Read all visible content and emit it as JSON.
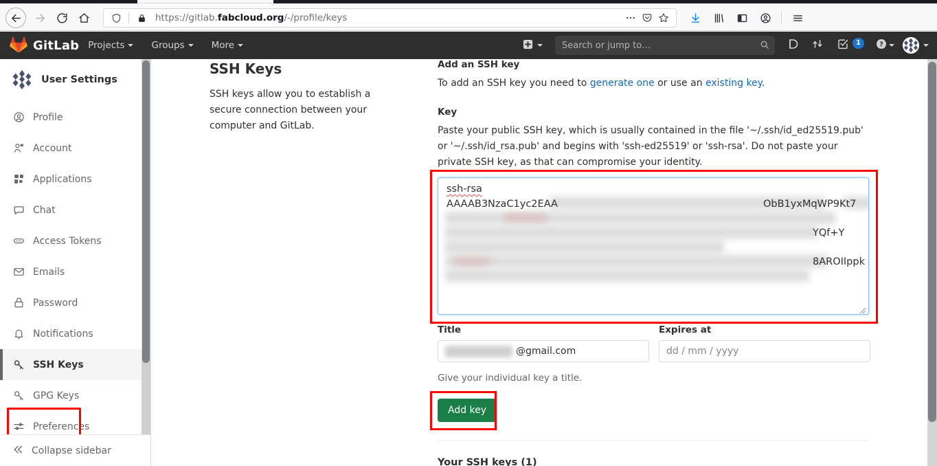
{
  "browser": {
    "url_scheme": "https://gitlab.",
    "url_domain": "fabcloud.org",
    "url_path": "/-/profile/keys",
    "back_icon": "back-arrow-icon",
    "forward_icon": "forward-arrow-icon",
    "reload_icon": "reload-icon",
    "home_icon": "home-icon",
    "shield_icon": "tracking-protection-shield-icon",
    "lock_icon": "padlock-icon",
    "page_actions_icon": "ellipsis-icon",
    "pocket_icon": "pocket-icon",
    "bookmark_icon": "star-icon",
    "download_icon": "downloads-icon",
    "library_icon": "library-icon",
    "sidebar_icon": "sidebar-toggle-icon",
    "account_icon": "firefox-account-icon",
    "menu_icon": "hamburger-menu-icon"
  },
  "navbar": {
    "brand": "GitLab",
    "brand_icon": "gitlab-tanuki-logo",
    "items": [
      {
        "label": "Projects",
        "caret": true
      },
      {
        "label": "Groups",
        "caret": true
      },
      {
        "label": "More",
        "caret": true
      }
    ],
    "plus_icon": "plus-square-icon",
    "search_placeholder": "Search or jump to…",
    "search_value": "",
    "search_icon": "search-icon",
    "issues_icon": "issues-icon",
    "merge_requests_icon": "merge-request-icon",
    "todos_icon": "todos-icon",
    "todos_count": "1",
    "todos_badge_color": "#1f75cb",
    "help_icon": "help-question-icon",
    "avatar_icon": "user-avatar-identicon"
  },
  "sidebar": {
    "title": "User Settings",
    "avatar_icon": "user-avatar-identicon",
    "items": [
      {
        "label": "Profile",
        "icon": "user-circle-icon",
        "active": false
      },
      {
        "label": "Account",
        "icon": "account-gear-icon",
        "active": false
      },
      {
        "label": "Applications",
        "icon": "applications-grid-icon",
        "active": false
      },
      {
        "label": "Chat",
        "icon": "chat-bubble-icon",
        "active": false
      },
      {
        "label": "Access Tokens",
        "icon": "token-pill-icon",
        "active": false
      },
      {
        "label": "Emails",
        "icon": "envelope-icon",
        "active": false
      },
      {
        "label": "Password",
        "icon": "padlock-icon",
        "active": false
      },
      {
        "label": "Notifications",
        "icon": "bell-icon",
        "active": false
      },
      {
        "label": "SSH Keys",
        "icon": "key-icon",
        "active": true
      },
      {
        "label": "GPG Keys",
        "icon": "key-icon",
        "active": false
      },
      {
        "label": "Preferences",
        "icon": "sliders-icon",
        "active": false
      }
    ],
    "collapse_label": "Collapse sidebar",
    "collapse_icon": "double-chevron-left-icon"
  },
  "main": {
    "left": {
      "heading": "SSH Keys",
      "description": "SSH keys allow you to establish a secure connection between your computer and GitLab."
    },
    "right": {
      "add_heading": "Add an SSH key",
      "add_intro_pre": "To add an SSH key you need to ",
      "add_intro_link1": "generate one",
      "add_intro_mid": " or use an ",
      "add_intro_link2": "existing key",
      "add_intro_post": ".",
      "key_label": "Key",
      "key_help": "Paste your public SSH key, which is usually contained in the file '~/.ssh/id_ed25519.pub' or '~/.ssh/id_rsa.pub' and begins with 'ssh-ed25519' or 'ssh-rsa'. Do not paste your private SSH key, as that can compromise your identity.",
      "key_textarea_lines": {
        "line1": "ssh-rsa",
        "line2_prefix": "AAAAB3NzaC1yc2EAA",
        "line2_suffix": "ObB1yxMqWP9Kt7",
        "line4_suffix": "YQf+Y",
        "line6_suffix": "8AROIIppk"
      },
      "title_label": "Title",
      "title_value_suffix": "@gmail.com",
      "title_help": "Give your individual key a title.",
      "expires_label": "Expires at",
      "expires_placeholder": "dd / mm / yyyy",
      "add_key_button": "Add key",
      "add_key_color": "#1a7f47",
      "your_keys_heading": "Your SSH keys (1)",
      "annotation_color": "#ff0000"
    }
  }
}
